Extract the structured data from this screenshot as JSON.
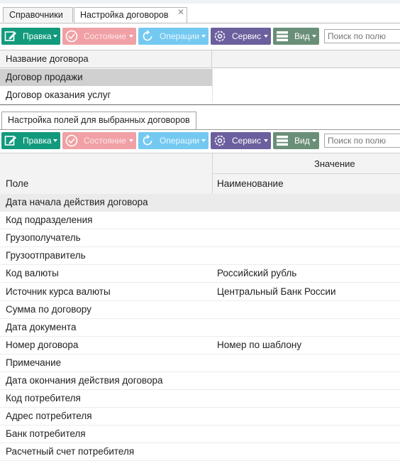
{
  "tabs": [
    {
      "label": "Справочники",
      "active": false
    },
    {
      "label": "Настройка договоров",
      "active": true,
      "closable": true
    }
  ],
  "toolbar": {
    "edit": "Правка",
    "state": "Состояние",
    "operations": "Операции",
    "service": "Сервис",
    "view": "Вид",
    "search_placeholder": "Поиск по полю"
  },
  "contracts": {
    "header": "Название договора",
    "rows": [
      "Договор продажи",
      "Договор оказания услуг"
    ],
    "selected_index": 0
  },
  "fields_panel": {
    "tab": "Настройка полей для выбранных договоров",
    "group_header": "Значение",
    "col_field": "Поле",
    "col_name": "Наименование",
    "rows": [
      {
        "field": "Дата начала действия договора",
        "name": ""
      },
      {
        "field": "Код подразделения",
        "name": ""
      },
      {
        "field": "Грузополучатель",
        "name": ""
      },
      {
        "field": "Грузоотправитель",
        "name": ""
      },
      {
        "field": "Код валюты",
        "name": "Российский рубль"
      },
      {
        "field": "Источник курса валюты",
        "name": "Центральный Банк России"
      },
      {
        "field": "Сумма по договору",
        "name": ""
      },
      {
        "field": "Дата документа",
        "name": ""
      },
      {
        "field": "Номер договора",
        "name": "Номер по шаблону"
      },
      {
        "field": "Примечание",
        "name": ""
      },
      {
        "field": "Дата окончания действия договора",
        "name": ""
      },
      {
        "field": "Код потребителя",
        "name": ""
      },
      {
        "field": "Адрес потребителя",
        "name": ""
      },
      {
        "field": "Банк потребителя",
        "name": ""
      },
      {
        "field": "Расчетный счет потребителя",
        "name": ""
      }
    ],
    "highlighted_index": 0
  },
  "colors": {
    "edit": "#129a7d",
    "state": "#f0a1a5",
    "operations": "#74c9f1",
    "service": "#6b5f9e",
    "view": "#6a8f78"
  }
}
